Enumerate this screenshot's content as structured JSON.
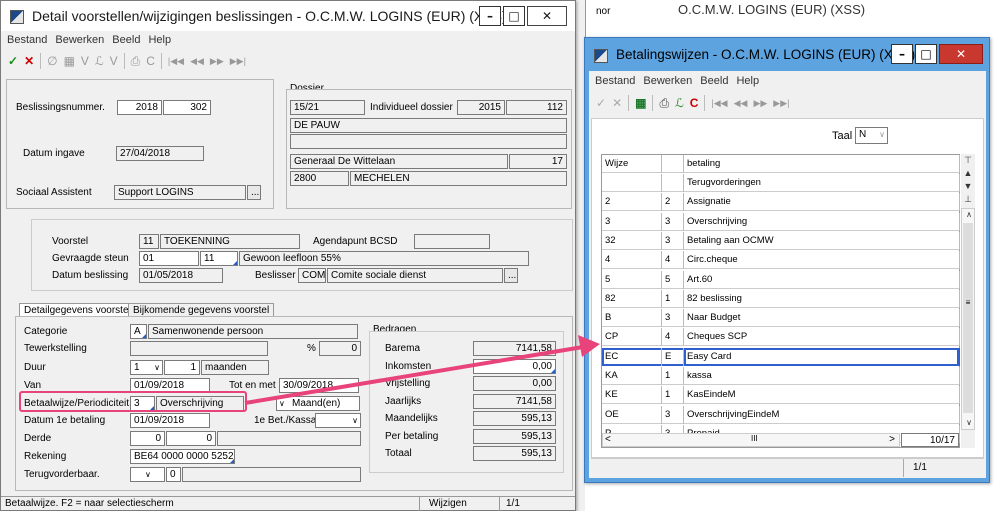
{
  "left_window": {
    "title": "Detail voorstellen/wijzigingen beslissingen - O.C.M.W. LOGINS (EUR) (XSS)",
    "menu": [
      "Bestand",
      "Bewerken",
      "Beeld",
      "Help"
    ],
    "toolbar_icons": [
      "check-icon",
      "cancel-icon",
      "delete-icon",
      "save-icon",
      "filter-icon",
      "chart-icon",
      "report-icon",
      "print-icon",
      "copy-icon",
      "first-icon",
      "prev-icon",
      "next-icon",
      "last-icon"
    ],
    "top": {
      "beslissingsnummer_label": "Beslissingsnummer.",
      "beslissing_year": "2018",
      "beslissing_nr": "302",
      "datum_ingave_label": "Datum ingave",
      "datum_ingave": "27/04/2018",
      "sociaal_assistent_label": "Sociaal Assistent",
      "sociaal_assistent": "Support LOGINS"
    },
    "dossier": {
      "label": "Dossier",
      "nr": "15/21",
      "individueel_label": "Individueel dossier",
      "ind_year": "2015",
      "ind_nr": "112",
      "naam": "DE PAUW",
      "straat": "Generaal De Wittelaan",
      "huisnr": "17",
      "postcode": "2800",
      "gemeente": "MECHELEN"
    },
    "voorstel": {
      "voorstel_label": "Voorstel",
      "voorstel_code": "11",
      "voorstel_text": "TOEKENNING",
      "agendapunt_label": "Agendapunt BCSD",
      "steun_label": "Gevraagde steun",
      "steun_1": "01",
      "steun_2": "11",
      "steun_text": "Gewoon leefloon 55%",
      "datum_label": "Datum beslissing",
      "datum": "01/05/2018",
      "beslisser_label": "Beslisser",
      "beslisser_code": "COM",
      "beslisser_text": "Comite sociale dienst"
    },
    "tabs": [
      "Detailgegevens voorstel",
      "Bijkomende gegevens voorstel"
    ],
    "detail": {
      "categorie_label": "Categorie",
      "categorie_code": "A",
      "categorie_text": "Samenwonende persoon",
      "tewerkstelling_label": "Tewerkstelling",
      "pct": "%",
      "pct_val": "0",
      "duur_label": "Duur",
      "duur_1": "1",
      "duur_2": "1",
      "duur_unit": "maanden",
      "van_label": "Van",
      "van": "01/09/2018",
      "tot_label": "Tot en met",
      "tot": "30/09/2018",
      "betaal_label": "Betaalwijze/Periodiciteit.",
      "betaal_code": "3",
      "betaal_text": "Overschrijving",
      "period": "Maand(en)",
      "datum1_label": "Datum 1e betaling",
      "datum1": "01/09/2018",
      "kassa_label": "1e Bet./Kassa",
      "derde_label": "Derde",
      "derde_1": "0",
      "derde_2": "0",
      "rekening_label": "Rekening",
      "rekening": "BE64 0000 0000 5252",
      "terug_label": "Terugvorderbaar.",
      "terug_val": "0"
    },
    "bedragen": {
      "label": "Bedragen",
      "rows": [
        {
          "label": "Barema",
          "value": "7141,58"
        },
        {
          "label": "Inkomsten",
          "value": "0,00"
        },
        {
          "label": "Vrijstelling",
          "value": "0,00"
        },
        {
          "label": "Jaarlijks",
          "value": "7141,58"
        },
        {
          "label": "Maandelijks",
          "value": "595,13"
        },
        {
          "label": "Per betaling",
          "value": "595,13"
        },
        {
          "label": "Totaal",
          "value": "595,13"
        }
      ]
    },
    "status": {
      "hint": "Betaalwijze. F2 = naar selectiescherm",
      "mode": "Wijzigen",
      "page": "1/1"
    }
  },
  "bg_window": {
    "title": "O.C.M.W. LOGINS (EUR) (XSS)",
    "frag": "nor"
  },
  "right_window": {
    "title": "Betalingswijzen - O.C.M.W. LOGINS (EUR) (XSS)",
    "menu": [
      "Bestand",
      "Bewerken",
      "Beeld",
      "Help"
    ],
    "taal_label": "Taal",
    "taal_value": "N",
    "headers": [
      "Wijze",
      "",
      "betaling"
    ],
    "rows": [
      {
        "c1": "",
        "c2": "",
        "c3": "Terugvorderingen"
      },
      {
        "c1": "2",
        "c2": "2",
        "c3": "Assignatie"
      },
      {
        "c1": "3",
        "c2": "3",
        "c3": "Overschrijving"
      },
      {
        "c1": "32",
        "c2": "3",
        "c3": "Betaling aan OCMW"
      },
      {
        "c1": "4",
        "c2": "4",
        "c3": "Circ.cheque"
      },
      {
        "c1": "5",
        "c2": "5",
        "c3": "Art.60"
      },
      {
        "c1": "82",
        "c2": "1",
        "c3": "82 beslissing"
      },
      {
        "c1": "B",
        "c2": "3",
        "c3": "Naar Budget"
      },
      {
        "c1": "CP",
        "c2": "4",
        "c3": "Cheques SCP"
      },
      {
        "c1": "EC",
        "c2": "E",
        "c3": "Easy Card"
      },
      {
        "c1": "KA",
        "c2": "1",
        "c3": "kassa"
      },
      {
        "c1": "KE",
        "c2": "1",
        "c3": "KasEindeM"
      },
      {
        "c1": "OE",
        "c2": "3",
        "c3": "OverschrijvingEindeM"
      },
      {
        "c1": "P",
        "c2": "3",
        "c3": "Prepaid"
      }
    ],
    "counter": "10/17",
    "pager": "1/1"
  },
  "colors": {
    "arrow": "#e8437a",
    "selection": "#2f5fd0"
  }
}
